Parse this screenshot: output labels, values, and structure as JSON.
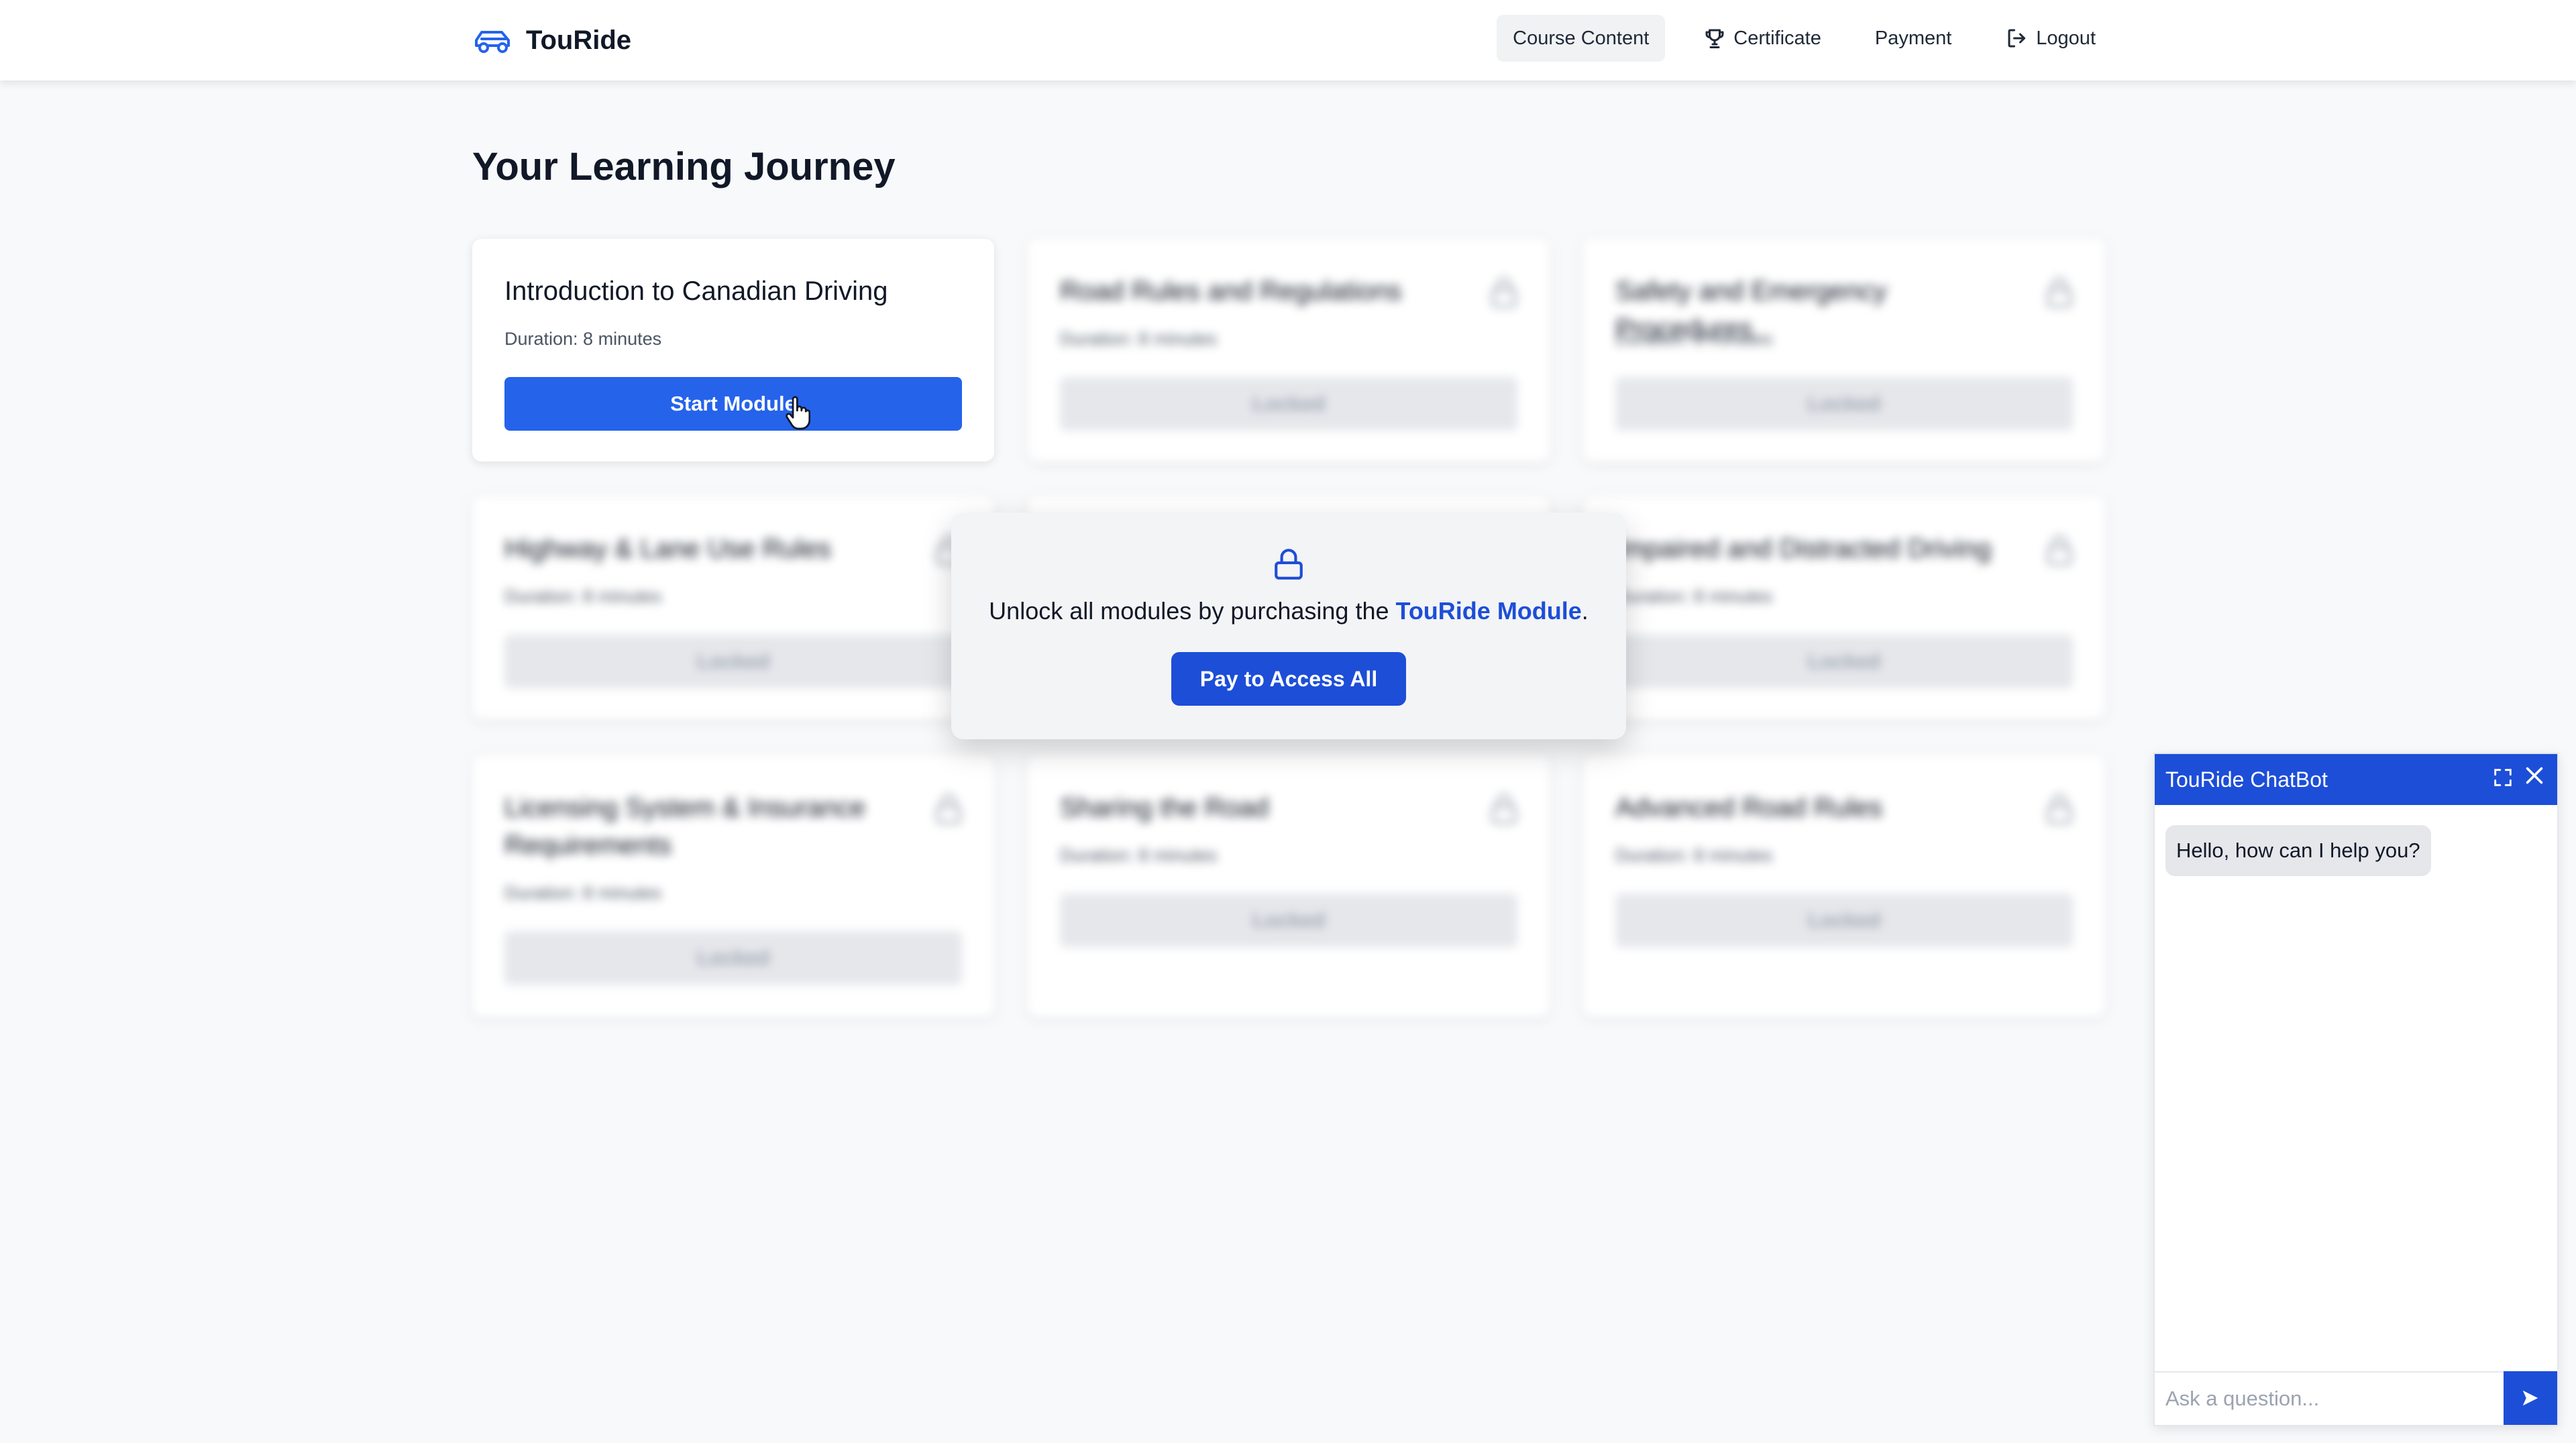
{
  "header": {
    "brand": "TouRide",
    "nav": [
      {
        "label": "Course Content",
        "icon": "none",
        "active": true
      },
      {
        "label": "Certificate",
        "icon": "trophy-icon",
        "active": false
      },
      {
        "label": "Payment",
        "icon": "none",
        "active": false
      },
      {
        "label": "Logout",
        "icon": "logout-icon",
        "active": false
      }
    ]
  },
  "page": {
    "title": "Your Learning Journey"
  },
  "modules": [
    {
      "title": "Introduction to Canadian Driving",
      "duration": "Duration: 8 minutes",
      "button": "Start Module",
      "locked": false
    },
    {
      "title": "Road Rules and Regulations",
      "duration": "Duration: 8 minutes",
      "button": "Locked",
      "locked": true
    },
    {
      "title": "Safety and Emergency Procedures",
      "duration": "Duration: 8 minutes",
      "button": "Locked",
      "locked": true
    },
    {
      "title": "Highway & Lane Use Rules",
      "duration": "Duration: 8 minutes",
      "button": "Locked",
      "locked": true
    },
    {
      "title": "Impaired and Distracted Driving",
      "duration": "Duration: 8 minutes",
      "button": "Locked",
      "locked": true
    },
    {
      "title": "Licensing System & Insurance Requirements",
      "duration": "Duration: 8 minutes",
      "button": "Locked",
      "locked": true
    },
    {
      "title": "Sharing the Road",
      "duration": "Duration: 8 minutes",
      "button": "Locked",
      "locked": true
    },
    {
      "title": "Advanced Road Rules",
      "duration": "Duration: 8 minutes",
      "button": "Locked",
      "locked": true
    }
  ],
  "unlock": {
    "message_prefix": "Unlock all modules by purchasing the ",
    "message_highlight": "TouRide Module",
    "message_suffix": ".",
    "button": "Pay to Access All"
  },
  "chatbot": {
    "title": "TouRide ChatBot",
    "greeting": "Hello, how can I help you?",
    "input_placeholder": "Ask a question..."
  },
  "colors": {
    "accent": "#2563eb",
    "accent_dark": "#1d4ed8",
    "background": "#f8f9fb"
  }
}
